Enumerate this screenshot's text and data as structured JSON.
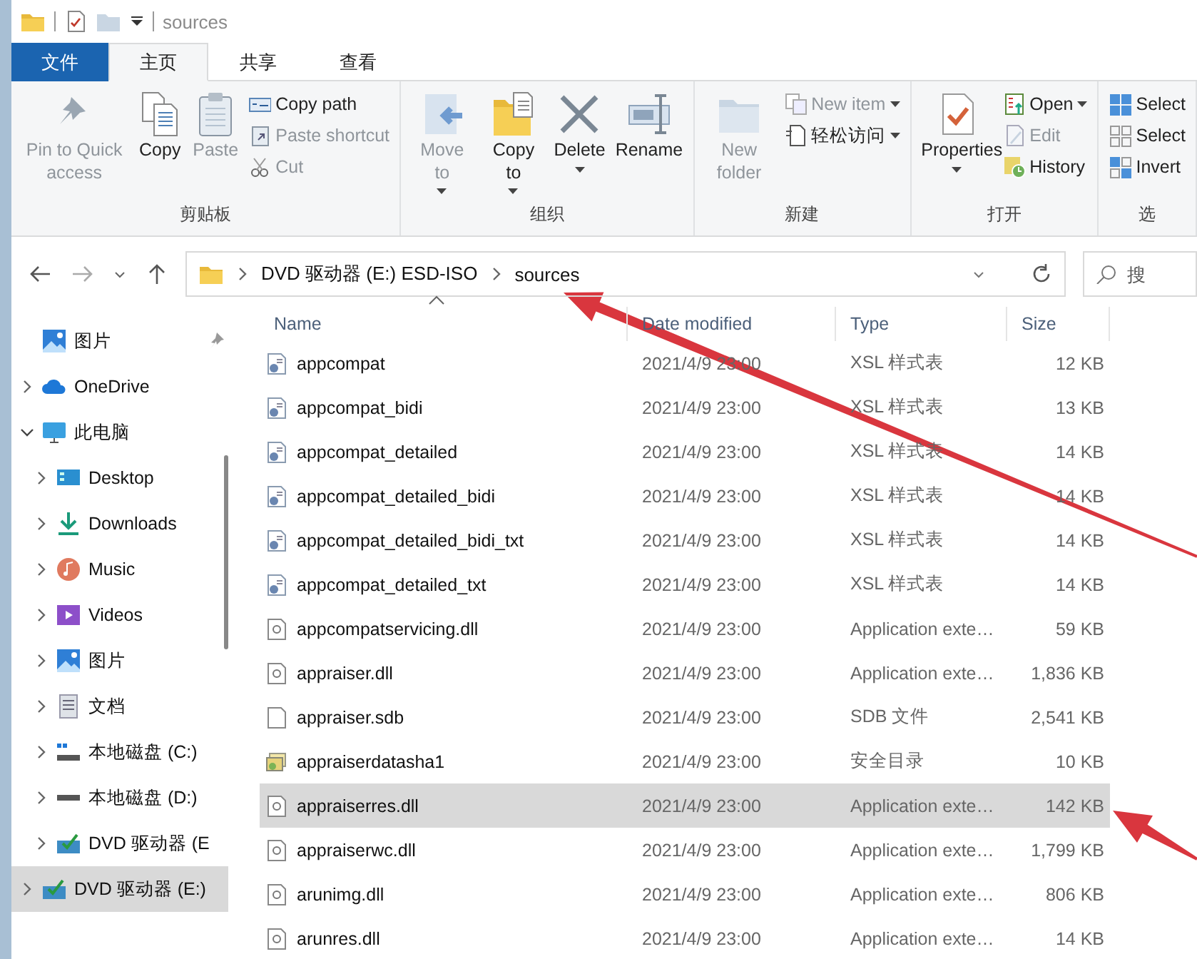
{
  "window": {
    "title": "sources"
  },
  "tabs": [
    {
      "label": "文件",
      "kind": "file",
      "selected": false
    },
    {
      "label": "主页",
      "kind": "tab",
      "selected": true
    },
    {
      "label": "共享",
      "kind": "tab",
      "selected": false
    },
    {
      "label": "查看",
      "kind": "tab",
      "selected": false
    }
  ],
  "ribbon": {
    "groups": [
      {
        "label": "剪贴板",
        "items": [
          {
            "kind": "large",
            "label": "Pin to Quick access",
            "disabled": true,
            "dropdown": false
          },
          {
            "kind": "large",
            "label": "Copy",
            "disabled": false,
            "dropdown": false
          },
          {
            "kind": "large",
            "label": "Paste",
            "disabled": true,
            "dropdown": false
          },
          {
            "kind": "small",
            "label": "Copy path",
            "disabled": false,
            "dropdown": false
          },
          {
            "kind": "small",
            "label": "Paste shortcut",
            "disabled": true,
            "dropdown": false
          },
          {
            "kind": "small",
            "label": "Cut",
            "disabled": true,
            "dropdown": false
          }
        ]
      },
      {
        "label": "组织",
        "items": [
          {
            "kind": "large",
            "label": "Move to",
            "disabled": true,
            "dropdown": true
          },
          {
            "kind": "large",
            "label": "Copy to",
            "disabled": false,
            "dropdown": true
          },
          {
            "kind": "large",
            "label": "Delete",
            "disabled": false,
            "dropdown": true
          },
          {
            "kind": "large",
            "label": "Rename",
            "disabled": false,
            "dropdown": false
          }
        ]
      },
      {
        "label": "新建",
        "items": [
          {
            "kind": "large",
            "label": "New folder",
            "disabled": true,
            "dropdown": false
          },
          {
            "kind": "small",
            "label": "New item",
            "disabled": true,
            "dropdown": true
          },
          {
            "kind": "small",
            "label": "轻松访问",
            "disabled": false,
            "dropdown": true
          }
        ]
      },
      {
        "label": "打开",
        "items": [
          {
            "kind": "large",
            "label": "Properties",
            "disabled": false,
            "dropdown": true
          },
          {
            "kind": "small",
            "label": "Open",
            "disabled": false,
            "dropdown": true
          },
          {
            "kind": "small",
            "label": "Edit",
            "disabled": true,
            "dropdown": false
          },
          {
            "kind": "small",
            "label": "History",
            "disabled": false,
            "dropdown": false
          }
        ]
      },
      {
        "label": "选",
        "items": [
          {
            "kind": "small",
            "label": "Select",
            "disabled": false,
            "dropdown": false
          },
          {
            "kind": "small",
            "label": "Select",
            "disabled": false,
            "dropdown": false
          },
          {
            "kind": "small",
            "label": "Invert",
            "disabled": false,
            "dropdown": false
          }
        ]
      }
    ]
  },
  "address": {
    "segments": [
      "DVD 驱动器 (E:) ESD-ISO",
      "sources"
    ],
    "search_placeholder": "搜"
  },
  "sidebar": {
    "items": [
      {
        "label": "图片",
        "pinned": true,
        "selected": false
      },
      {
        "label": "OneDrive",
        "expanded": false,
        "pinned": false,
        "selected": false
      },
      {
        "label": "此电脑",
        "expanded": true,
        "pinned": false,
        "selected": false,
        "children": [
          {
            "label": "Desktop",
            "expanded": false,
            "pinned": false,
            "selected": false
          },
          {
            "label": "Downloads",
            "expanded": false,
            "pinned": false,
            "selected": false
          },
          {
            "label": "Music",
            "expanded": false,
            "pinned": false,
            "selected": false
          },
          {
            "label": "Videos",
            "expanded": false,
            "pinned": false,
            "selected": false
          },
          {
            "label": "图片",
            "expanded": false,
            "pinned": false,
            "selected": false
          },
          {
            "label": "文档",
            "expanded": false,
            "pinned": false,
            "selected": false
          },
          {
            "label": "本地磁盘 (C:)",
            "expanded": false,
            "pinned": false,
            "selected": false
          },
          {
            "label": "本地磁盘 (D:)",
            "expanded": false,
            "pinned": false,
            "selected": false
          },
          {
            "label": "DVD 驱动器 (E",
            "expanded": false,
            "pinned": false,
            "selected": false
          }
        ]
      },
      {
        "label": "DVD 驱动器 (E:)",
        "expanded": false,
        "pinned": false,
        "selected": true
      }
    ]
  },
  "table": {
    "columns": [
      {
        "label": "Name",
        "sorted": true
      },
      {
        "label": "Date modified",
        "sorted": false
      },
      {
        "label": "Type",
        "sorted": false
      },
      {
        "label": "Size",
        "sorted": false
      }
    ],
    "rows": [
      {
        "kind": "stylesheet",
        "name": "appcompat",
        "date": "2021/4/9 23:00",
        "type": "XSL 样式表",
        "size": "12 KB",
        "selected": false
      },
      {
        "kind": "stylesheet",
        "name": "appcompat_bidi",
        "date": "2021/4/9 23:00",
        "type": "XSL 样式表",
        "size": "13 KB",
        "selected": false
      },
      {
        "kind": "stylesheet",
        "name": "appcompat_detailed",
        "date": "2021/4/9 23:00",
        "type": "XSL 样式表",
        "size": "14 KB",
        "selected": false
      },
      {
        "kind": "stylesheet",
        "name": "appcompat_detailed_bidi",
        "date": "2021/4/9 23:00",
        "type": "XSL 样式表",
        "size": "14 KB",
        "selected": false
      },
      {
        "kind": "stylesheet",
        "name": "appcompat_detailed_bidi_txt",
        "date": "2021/4/9 23:00",
        "type": "XSL 样式表",
        "size": "14 KB",
        "selected": false
      },
      {
        "kind": "stylesheet",
        "name": "appcompat_detailed_txt",
        "date": "2021/4/9 23:00",
        "type": "XSL 样式表",
        "size": "14 KB",
        "selected": false
      },
      {
        "kind": "library",
        "name": "appcompatservicing.dll",
        "date": "2021/4/9 23:00",
        "type": "Application exte…",
        "size": "59 KB",
        "selected": false
      },
      {
        "kind": "library",
        "name": "appraiser.dll",
        "date": "2021/4/9 23:00",
        "type": "Application exte…",
        "size": "1,836 KB",
        "selected": false
      },
      {
        "kind": "blank",
        "name": "appraiser.sdb",
        "date": "2021/4/9 23:00",
        "type": "SDB 文件",
        "size": "2,541 KB",
        "selected": false
      },
      {
        "kind": "catalog",
        "name": "appraiserdatasha1",
        "date": "2021/4/9 23:00",
        "type": "安全目录",
        "size": "10 KB",
        "selected": false
      },
      {
        "kind": "library",
        "name": "appraiserres.dll",
        "date": "2021/4/9 23:00",
        "type": "Application exte…",
        "size": "142 KB",
        "selected": true
      },
      {
        "kind": "library",
        "name": "appraiserwc.dll",
        "date": "2021/4/9 23:00",
        "type": "Application exte…",
        "size": "1,799 KB",
        "selected": false
      },
      {
        "kind": "library",
        "name": "arunimg.dll",
        "date": "2021/4/9 23:00",
        "type": "Application exte…",
        "size": "806 KB",
        "selected": false
      },
      {
        "kind": "library",
        "name": "arunres.dll",
        "date": "2021/4/9 23:00",
        "type": "Application exte…",
        "size": "14 KB",
        "selected": false
      }
    ]
  },
  "annotations": [
    {
      "kind": "arrow"
    },
    {
      "kind": "arrow"
    }
  ]
}
